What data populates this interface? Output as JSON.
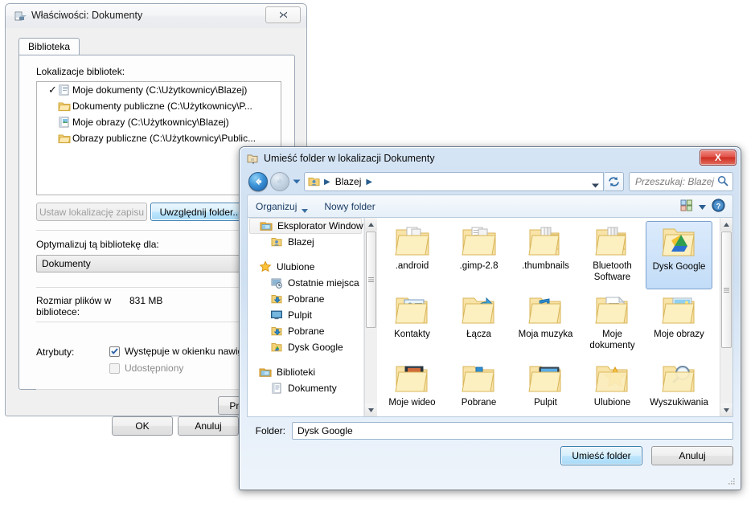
{
  "properties_dialog": {
    "title": "Właściwości: Dokumenty",
    "title_icon": "library-properties-icon",
    "close_button": "close-icon",
    "tabs": [
      {
        "label": "Biblioteka",
        "selected": true
      }
    ],
    "locations_label": "Lokalizacje bibliotek:",
    "locations": [
      {
        "checked": true,
        "icon": "documents-library-icon",
        "label": "Moje dokumenty (C:\\Użytkownicy\\Blazej)"
      },
      {
        "checked": false,
        "icon": "folder-icon",
        "label": "Dokumenty publiczne (C:\\Użytkownicy\\P..."
      },
      {
        "checked": false,
        "icon": "pictures-library-icon",
        "label": "Moje obrazy (C:\\Użytkownicy\\Blazej)"
      },
      {
        "checked": false,
        "icon": "folder-icon",
        "label": "Obrazy publiczne (C:\\Użytkownicy\\Public..."
      }
    ],
    "buttons": {
      "set_save_location": "Ustaw lokalizację zapisu",
      "include_folder": "Uwzględnij folder...",
      "third_partial": "",
      "restore": "Przywróć",
      "ok": "OK",
      "cancel": "Anuluj"
    },
    "optimize_label": "Optymalizuj tą bibliotekę dla:",
    "optimize_value": "Dokumenty",
    "size_label": "Rozmiar plików w bibliotece:",
    "size_value": "831 MB",
    "attributes_label": "Atrybuty:",
    "attributes": [
      {
        "label": "Występuje w okienku nawigacji",
        "checked": true,
        "enabled": true
      },
      {
        "label": "Udostępniony",
        "checked": false,
        "enabled": false
      }
    ]
  },
  "browse_dialog": {
    "title": "Umieść folder w lokalizacji Dokumenty",
    "title_icon": "folder-move-icon",
    "close_button": "X",
    "nav": {
      "back_icon": "arrow-left-icon",
      "forward_icon": "arrow-right-icon",
      "recent_icon": "chevron-down-icon",
      "address_icon": "user-folder-icon",
      "crumbs": [
        "Blazej"
      ],
      "dropdown_icon": "chevron-down-icon",
      "refresh_icon": "refresh-icon"
    },
    "search_placeholder": "Przeszukaj: Blazej",
    "search_icon": "search-icon",
    "toolbar": {
      "organize": "Organizuj",
      "new_folder": "Nowy folder",
      "view_icon": "view-mode-icon",
      "view_caret_icon": "chevron-down-icon",
      "help_icon": "help-icon"
    },
    "navigation_pane": [
      {
        "label": "Eksplorator Windows",
        "icon": "explorer-icon",
        "indent": false,
        "selected": true
      },
      {
        "label": "Blazej",
        "icon": "user-folder-icon",
        "indent": true,
        "selected": false
      },
      {
        "gap": true
      },
      {
        "label": "Ulubione",
        "icon": "star-icon",
        "indent": false,
        "selected": false
      },
      {
        "label": "Ostatnie miejsca",
        "icon": "recent-icon",
        "indent": true,
        "selected": false
      },
      {
        "label": "Pobrane",
        "icon": "downloads-icon",
        "indent": true,
        "selected": false
      },
      {
        "label": "Pulpit",
        "icon": "desktop-icon",
        "indent": true,
        "selected": false
      },
      {
        "label": "Pobrane",
        "icon": "downloads-icon",
        "indent": true,
        "selected": false
      },
      {
        "label": "Dysk Google",
        "icon": "gdrive-folder-icon",
        "indent": true,
        "selected": false
      },
      {
        "gap": true
      },
      {
        "label": "Biblioteki",
        "icon": "libraries-icon",
        "indent": false,
        "selected": false
      },
      {
        "label": "Dokumenty",
        "icon": "documents-library-icon",
        "indent": true,
        "selected": false
      }
    ],
    "files": [
      {
        "name": ".android",
        "icon": "folder-docs-icon",
        "selected": false
      },
      {
        "name": ".gimp-2.8",
        "icon": "folder-docs-icon",
        "selected": false
      },
      {
        "name": ".thumbnails",
        "icon": "folder-stack-icon",
        "selected": false
      },
      {
        "name": "Bluetooth Software",
        "icon": "folder-stack-icon",
        "selected": false
      },
      {
        "name": "Dysk Google",
        "icon": "folder-gdrive-icon",
        "selected": true
      },
      {
        "name": "Kontakty",
        "icon": "folder-contacts-icon",
        "selected": false
      },
      {
        "name": "Łącza",
        "icon": "folder-links-icon",
        "selected": false
      },
      {
        "name": "Moja muzyka",
        "icon": "folder-music-icon",
        "selected": false
      },
      {
        "name": "Moje dokumenty",
        "icon": "folder-documents-icon",
        "selected": false
      },
      {
        "name": "Moje obrazy",
        "icon": "folder-pictures-icon",
        "selected": false
      },
      {
        "name": "Moje wideo",
        "icon": "folder-video-icon",
        "selected": false
      },
      {
        "name": "Pobrane",
        "icon": "folder-download-icon",
        "selected": false
      },
      {
        "name": "Pulpit",
        "icon": "folder-desktop-icon",
        "selected": false
      },
      {
        "name": "Ulubione",
        "icon": "folder-favorites-icon",
        "selected": false
      },
      {
        "name": "Wyszukiwania",
        "icon": "folder-search-icon",
        "selected": false
      }
    ],
    "folder_label": "Folder:",
    "folder_value": "Dysk Google",
    "actions": {
      "confirm": "Umieść folder",
      "cancel": "Anuluj"
    }
  },
  "colors": {
    "accent_blue": "#3c7fb1",
    "selection_fill": "#c2dcf7",
    "close_red": "#cf2d22",
    "folder_yellow": "#fcd97f"
  }
}
